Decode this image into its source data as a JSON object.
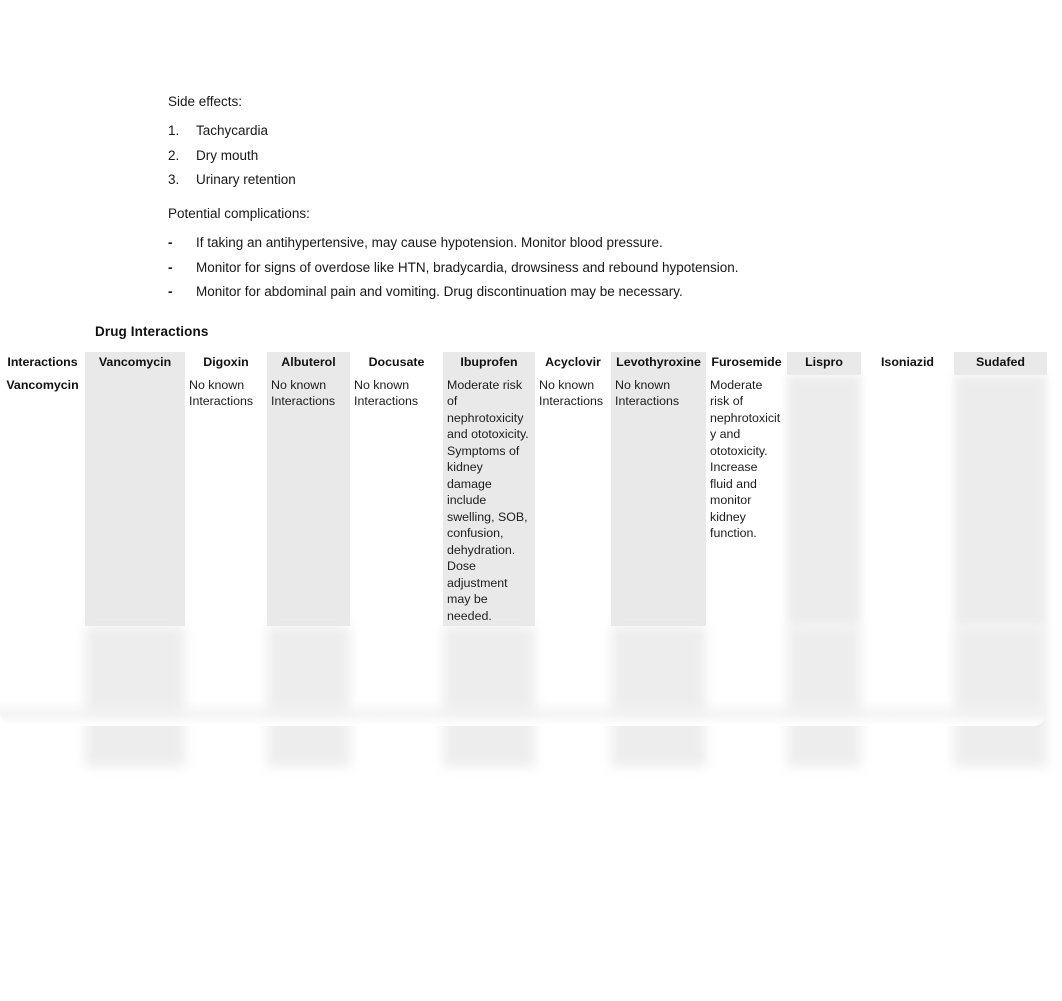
{
  "document": {
    "side_effects_heading": "Side effects:",
    "side_effects": [
      {
        "num": "1.",
        "text": "Tachycardia"
      },
      {
        "num": "2.",
        "text": "Dry mouth"
      },
      {
        "num": "3.",
        "text": "Urinary retention"
      }
    ],
    "complications_heading": "Potential complications:",
    "complications": [
      {
        "marker": "-",
        "text": "If taking an antihypertensive, may cause hypotension.  Monitor blood pressure."
      },
      {
        "marker": "-",
        "text": "Monitor for signs of overdose like HTN, bradycardia, drowsiness and rebound hypotension."
      },
      {
        "marker": "-",
        "text": "Monitor for abdominal pain and vomiting.  Drug discontinuation may be necessary."
      }
    ]
  },
  "table": {
    "title": "Drug Interactions",
    "headers": [
      "Interactions",
      "Vancomycin",
      "Digoxin",
      "Albuterol",
      "Docusate",
      "Ibuprofen",
      "Acyclovir",
      "Levothyroxine",
      "Furosemide",
      "Lispro",
      "Isoniazid",
      "Sudafed"
    ],
    "rows": [
      {
        "row_label": "Vancomycin",
        "cells": [
          "",
          "No known Interactions",
          "No known Interactions",
          "No known Interactions",
          "Moderate risk of nephrotoxicity and ototoxicity. Symptoms of kidney damage include swelling, SOB, confusion, dehydration. Dose adjustment may be needed.",
          "No known Interactions",
          "No known Interactions",
          "Moderate risk of nephrotoxicity and ototoxicity. Increase fluid and monitor kidney function.",
          "",
          "",
          ""
        ],
        "obscured_cells": [
          8,
          9,
          10
        ]
      },
      {
        "row_label": "",
        "cells": [
          "",
          "",
          "",
          "",
          "",
          "",
          "",
          "",
          "",
          "",
          ""
        ],
        "fully_obscured": true
      }
    ]
  },
  "colors": {
    "page_background": "#ffffff",
    "band_column": "#e9e9e9",
    "text": "#1a1a1a"
  }
}
